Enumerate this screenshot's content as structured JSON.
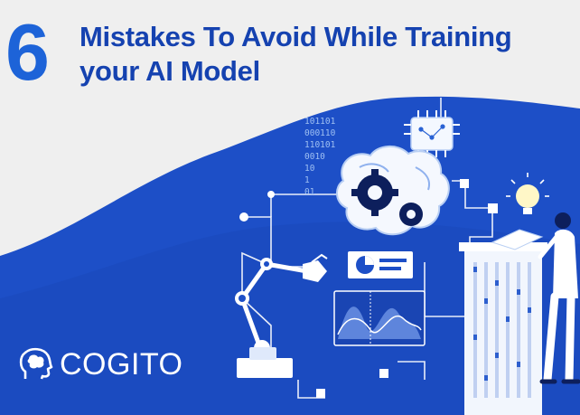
{
  "banner": {
    "number": "6",
    "title_line1": "Mistakes To Avoid While Training",
    "title_line2": "your AI Model"
  },
  "brand": {
    "name": "COGITO",
    "logo_icon": "head-brain-icon"
  },
  "illustration": {
    "binary_rows": [
      "101101",
      "000110",
      "110101",
      "0010",
      "10",
      "1",
      "01"
    ]
  },
  "colors": {
    "number": "#1d63d8",
    "title": "#1542b0",
    "wave": "#1d4fc7",
    "background": "#efefef",
    "line_art": "#ffffff"
  }
}
